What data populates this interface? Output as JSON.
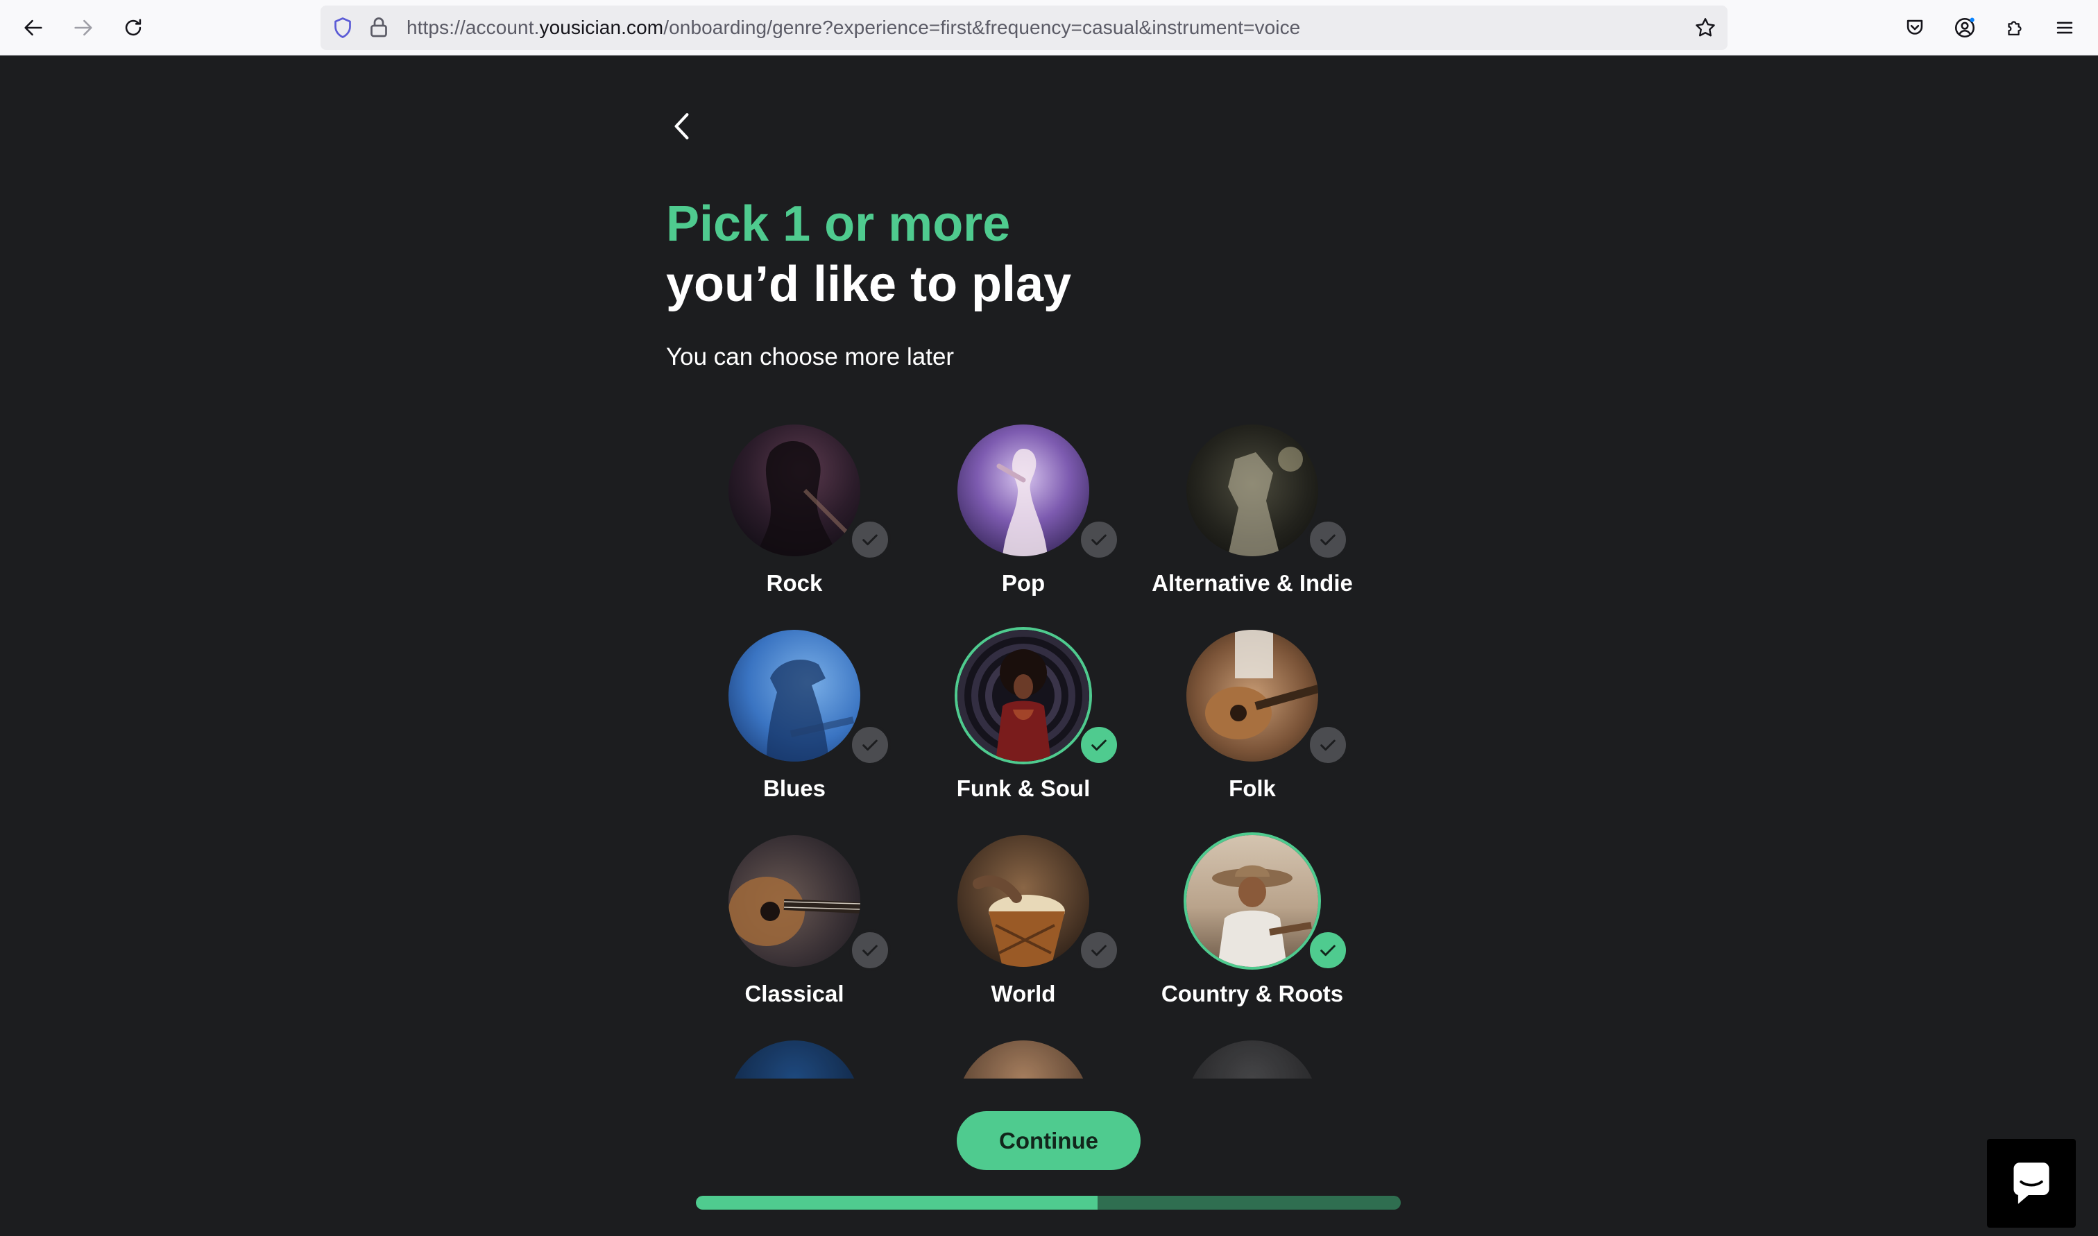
{
  "browser": {
    "url_prefix": "https://account.",
    "url_domain": "yousician.com",
    "url_path": "/onboarding/genre?experience=first&frequency=casual&instrument=voice"
  },
  "page": {
    "title_accent": "Pick 1 or more",
    "title_main": "you’d like to play",
    "subtitle": "You can choose more later",
    "continue_label": "Continue",
    "progress_fraction": 0.57
  },
  "colors": {
    "accent": "#4fcb8f",
    "background": "#1c1d1f",
    "progress_track": "#2f6e50"
  },
  "genres": [
    {
      "label": "Rock",
      "selected": false,
      "icon": "rock-photo"
    },
    {
      "label": "Pop",
      "selected": false,
      "icon": "pop-photo"
    },
    {
      "label": "Alternative & Indie",
      "selected": false,
      "icon": "alternative-indie-photo"
    },
    {
      "label": "Blues",
      "selected": false,
      "icon": "blues-photo"
    },
    {
      "label": "Funk & Soul",
      "selected": true,
      "icon": "funk-soul-photo"
    },
    {
      "label": "Folk",
      "selected": false,
      "icon": "folk-photo"
    },
    {
      "label": "Classical",
      "selected": false,
      "icon": "classical-photo"
    },
    {
      "label": "World",
      "selected": false,
      "icon": "world-photo"
    },
    {
      "label": "Country & Roots",
      "selected": true,
      "icon": "country-roots-photo"
    }
  ]
}
